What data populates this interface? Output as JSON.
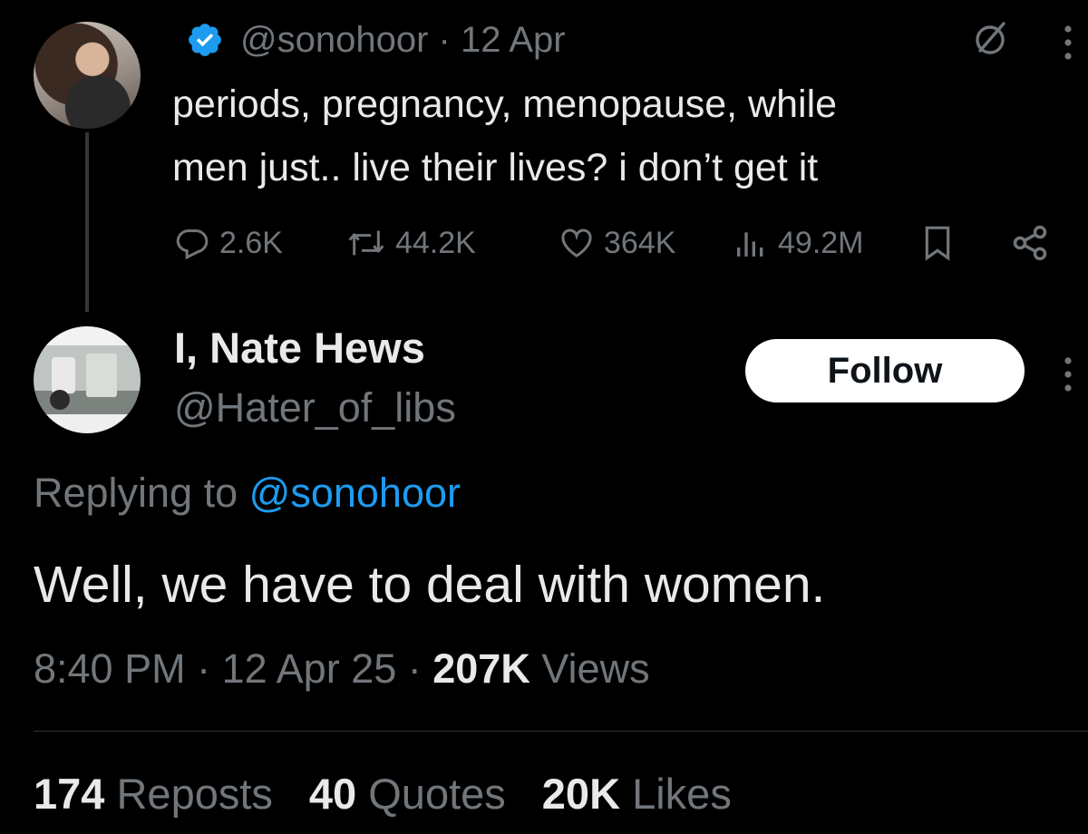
{
  "original_tweet": {
    "handle": "@sonohoor",
    "date": "12 Apr",
    "text_line1": "periods, pregnancy, menopause, while",
    "text_line2": "men just.. live their lives? i don’t get it",
    "replies": "2.6K",
    "reposts": "44.2K",
    "likes": "364K",
    "views": "49.2M"
  },
  "reply_tweet": {
    "display_name": "I, Nate Hews",
    "handle": "@Hater_of_libs",
    "follow_label": "Follow",
    "replying_to_prefix": "Replying to",
    "replying_to_handle": "@sonohoor",
    "text": "Well, we have to deal with women.",
    "time": "8:40 PM",
    "date": "12 Apr 25",
    "views_count": "207K",
    "views_label": "Views"
  },
  "engagement": {
    "reposts_count": "174",
    "reposts_label": "Reposts",
    "quotes_count": "40",
    "quotes_label": "Quotes",
    "likes_count": "20K",
    "likes_label": "Likes"
  },
  "colors": {
    "background": "#000000",
    "text": "#e7e9ea",
    "muted": "#71767b",
    "accent": "#1d9bf0"
  },
  "icons": [
    "verified-badge-icon",
    "grok-icon",
    "more-icon",
    "reply-icon",
    "repost-icon",
    "like-icon",
    "views-icon",
    "bookmark-icon",
    "share-icon"
  ]
}
